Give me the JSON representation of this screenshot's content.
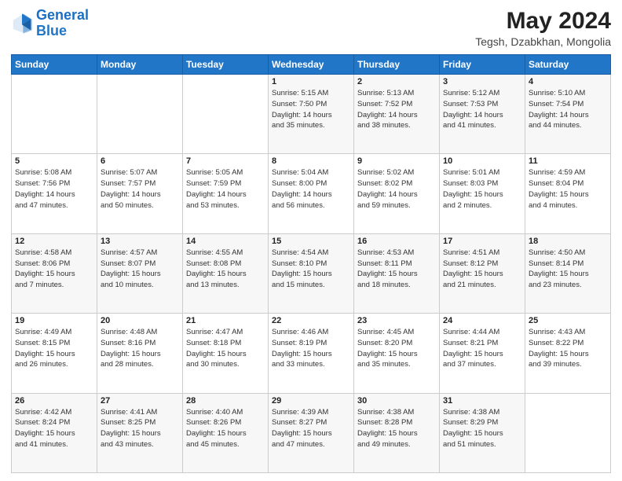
{
  "header": {
    "logo_line1": "General",
    "logo_line2": "Blue",
    "month_year": "May 2024",
    "location": "Tegsh, Dzabkhan, Mongolia"
  },
  "weekdays": [
    "Sunday",
    "Monday",
    "Tuesday",
    "Wednesday",
    "Thursday",
    "Friday",
    "Saturday"
  ],
  "weeks": [
    [
      {
        "day": "",
        "info": ""
      },
      {
        "day": "",
        "info": ""
      },
      {
        "day": "",
        "info": ""
      },
      {
        "day": "1",
        "info": "Sunrise: 5:15 AM\nSunset: 7:50 PM\nDaylight: 14 hours\nand 35 minutes."
      },
      {
        "day": "2",
        "info": "Sunrise: 5:13 AM\nSunset: 7:52 PM\nDaylight: 14 hours\nand 38 minutes."
      },
      {
        "day": "3",
        "info": "Sunrise: 5:12 AM\nSunset: 7:53 PM\nDaylight: 14 hours\nand 41 minutes."
      },
      {
        "day": "4",
        "info": "Sunrise: 5:10 AM\nSunset: 7:54 PM\nDaylight: 14 hours\nand 44 minutes."
      }
    ],
    [
      {
        "day": "5",
        "info": "Sunrise: 5:08 AM\nSunset: 7:56 PM\nDaylight: 14 hours\nand 47 minutes."
      },
      {
        "day": "6",
        "info": "Sunrise: 5:07 AM\nSunset: 7:57 PM\nDaylight: 14 hours\nand 50 minutes."
      },
      {
        "day": "7",
        "info": "Sunrise: 5:05 AM\nSunset: 7:59 PM\nDaylight: 14 hours\nand 53 minutes."
      },
      {
        "day": "8",
        "info": "Sunrise: 5:04 AM\nSunset: 8:00 PM\nDaylight: 14 hours\nand 56 minutes."
      },
      {
        "day": "9",
        "info": "Sunrise: 5:02 AM\nSunset: 8:02 PM\nDaylight: 14 hours\nand 59 minutes."
      },
      {
        "day": "10",
        "info": "Sunrise: 5:01 AM\nSunset: 8:03 PM\nDaylight: 15 hours\nand 2 minutes."
      },
      {
        "day": "11",
        "info": "Sunrise: 4:59 AM\nSunset: 8:04 PM\nDaylight: 15 hours\nand 4 minutes."
      }
    ],
    [
      {
        "day": "12",
        "info": "Sunrise: 4:58 AM\nSunset: 8:06 PM\nDaylight: 15 hours\nand 7 minutes."
      },
      {
        "day": "13",
        "info": "Sunrise: 4:57 AM\nSunset: 8:07 PM\nDaylight: 15 hours\nand 10 minutes."
      },
      {
        "day": "14",
        "info": "Sunrise: 4:55 AM\nSunset: 8:08 PM\nDaylight: 15 hours\nand 13 minutes."
      },
      {
        "day": "15",
        "info": "Sunrise: 4:54 AM\nSunset: 8:10 PM\nDaylight: 15 hours\nand 15 minutes."
      },
      {
        "day": "16",
        "info": "Sunrise: 4:53 AM\nSunset: 8:11 PM\nDaylight: 15 hours\nand 18 minutes."
      },
      {
        "day": "17",
        "info": "Sunrise: 4:51 AM\nSunset: 8:12 PM\nDaylight: 15 hours\nand 21 minutes."
      },
      {
        "day": "18",
        "info": "Sunrise: 4:50 AM\nSunset: 8:14 PM\nDaylight: 15 hours\nand 23 minutes."
      }
    ],
    [
      {
        "day": "19",
        "info": "Sunrise: 4:49 AM\nSunset: 8:15 PM\nDaylight: 15 hours\nand 26 minutes."
      },
      {
        "day": "20",
        "info": "Sunrise: 4:48 AM\nSunset: 8:16 PM\nDaylight: 15 hours\nand 28 minutes."
      },
      {
        "day": "21",
        "info": "Sunrise: 4:47 AM\nSunset: 8:18 PM\nDaylight: 15 hours\nand 30 minutes."
      },
      {
        "day": "22",
        "info": "Sunrise: 4:46 AM\nSunset: 8:19 PM\nDaylight: 15 hours\nand 33 minutes."
      },
      {
        "day": "23",
        "info": "Sunrise: 4:45 AM\nSunset: 8:20 PM\nDaylight: 15 hours\nand 35 minutes."
      },
      {
        "day": "24",
        "info": "Sunrise: 4:44 AM\nSunset: 8:21 PM\nDaylight: 15 hours\nand 37 minutes."
      },
      {
        "day": "25",
        "info": "Sunrise: 4:43 AM\nSunset: 8:22 PM\nDaylight: 15 hours\nand 39 minutes."
      }
    ],
    [
      {
        "day": "26",
        "info": "Sunrise: 4:42 AM\nSunset: 8:24 PM\nDaylight: 15 hours\nand 41 minutes."
      },
      {
        "day": "27",
        "info": "Sunrise: 4:41 AM\nSunset: 8:25 PM\nDaylight: 15 hours\nand 43 minutes."
      },
      {
        "day": "28",
        "info": "Sunrise: 4:40 AM\nSunset: 8:26 PM\nDaylight: 15 hours\nand 45 minutes."
      },
      {
        "day": "29",
        "info": "Sunrise: 4:39 AM\nSunset: 8:27 PM\nDaylight: 15 hours\nand 47 minutes."
      },
      {
        "day": "30",
        "info": "Sunrise: 4:38 AM\nSunset: 8:28 PM\nDaylight: 15 hours\nand 49 minutes."
      },
      {
        "day": "31",
        "info": "Sunrise: 4:38 AM\nSunset: 8:29 PM\nDaylight: 15 hours\nand 51 minutes."
      },
      {
        "day": "",
        "info": ""
      }
    ]
  ]
}
